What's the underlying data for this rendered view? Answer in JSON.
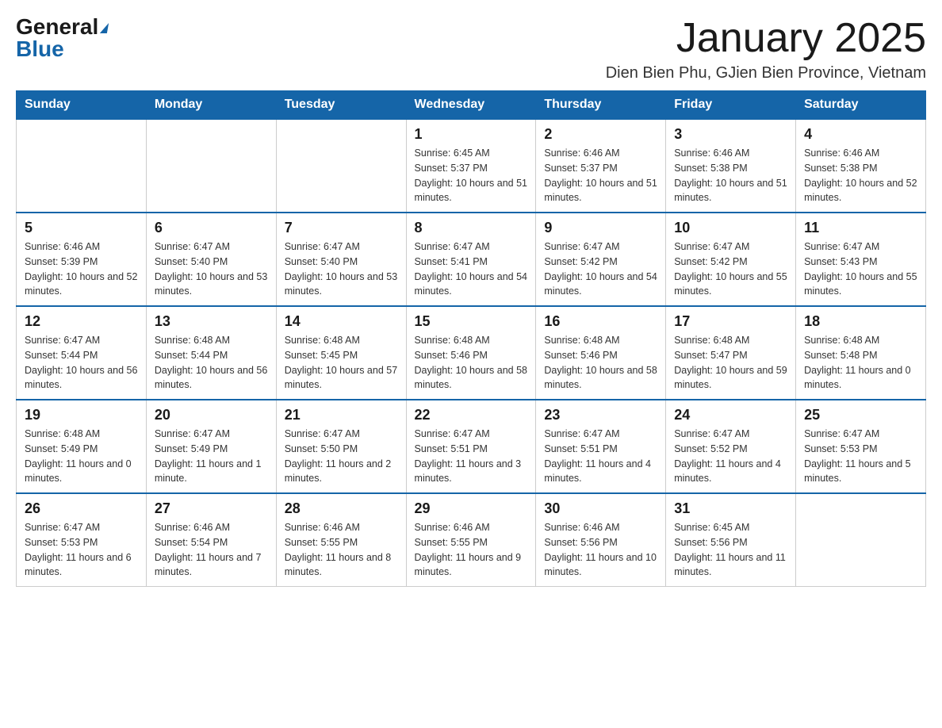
{
  "logo": {
    "general": "General",
    "blue": "Blue"
  },
  "header": {
    "month": "January 2025",
    "location": "Dien Bien Phu, GJien Bien Province, Vietnam"
  },
  "weekdays": [
    "Sunday",
    "Monday",
    "Tuesday",
    "Wednesday",
    "Thursday",
    "Friday",
    "Saturday"
  ],
  "weeks": [
    [
      {
        "day": "",
        "info": ""
      },
      {
        "day": "",
        "info": ""
      },
      {
        "day": "",
        "info": ""
      },
      {
        "day": "1",
        "info": "Sunrise: 6:45 AM\nSunset: 5:37 PM\nDaylight: 10 hours and 51 minutes."
      },
      {
        "day": "2",
        "info": "Sunrise: 6:46 AM\nSunset: 5:37 PM\nDaylight: 10 hours and 51 minutes."
      },
      {
        "day": "3",
        "info": "Sunrise: 6:46 AM\nSunset: 5:38 PM\nDaylight: 10 hours and 51 minutes."
      },
      {
        "day": "4",
        "info": "Sunrise: 6:46 AM\nSunset: 5:38 PM\nDaylight: 10 hours and 52 minutes."
      }
    ],
    [
      {
        "day": "5",
        "info": "Sunrise: 6:46 AM\nSunset: 5:39 PM\nDaylight: 10 hours and 52 minutes."
      },
      {
        "day": "6",
        "info": "Sunrise: 6:47 AM\nSunset: 5:40 PM\nDaylight: 10 hours and 53 minutes."
      },
      {
        "day": "7",
        "info": "Sunrise: 6:47 AM\nSunset: 5:40 PM\nDaylight: 10 hours and 53 minutes."
      },
      {
        "day": "8",
        "info": "Sunrise: 6:47 AM\nSunset: 5:41 PM\nDaylight: 10 hours and 54 minutes."
      },
      {
        "day": "9",
        "info": "Sunrise: 6:47 AM\nSunset: 5:42 PM\nDaylight: 10 hours and 54 minutes."
      },
      {
        "day": "10",
        "info": "Sunrise: 6:47 AM\nSunset: 5:42 PM\nDaylight: 10 hours and 55 minutes."
      },
      {
        "day": "11",
        "info": "Sunrise: 6:47 AM\nSunset: 5:43 PM\nDaylight: 10 hours and 55 minutes."
      }
    ],
    [
      {
        "day": "12",
        "info": "Sunrise: 6:47 AM\nSunset: 5:44 PM\nDaylight: 10 hours and 56 minutes."
      },
      {
        "day": "13",
        "info": "Sunrise: 6:48 AM\nSunset: 5:44 PM\nDaylight: 10 hours and 56 minutes."
      },
      {
        "day": "14",
        "info": "Sunrise: 6:48 AM\nSunset: 5:45 PM\nDaylight: 10 hours and 57 minutes."
      },
      {
        "day": "15",
        "info": "Sunrise: 6:48 AM\nSunset: 5:46 PM\nDaylight: 10 hours and 58 minutes."
      },
      {
        "day": "16",
        "info": "Sunrise: 6:48 AM\nSunset: 5:46 PM\nDaylight: 10 hours and 58 minutes."
      },
      {
        "day": "17",
        "info": "Sunrise: 6:48 AM\nSunset: 5:47 PM\nDaylight: 10 hours and 59 minutes."
      },
      {
        "day": "18",
        "info": "Sunrise: 6:48 AM\nSunset: 5:48 PM\nDaylight: 11 hours and 0 minutes."
      }
    ],
    [
      {
        "day": "19",
        "info": "Sunrise: 6:48 AM\nSunset: 5:49 PM\nDaylight: 11 hours and 0 minutes."
      },
      {
        "day": "20",
        "info": "Sunrise: 6:47 AM\nSunset: 5:49 PM\nDaylight: 11 hours and 1 minute."
      },
      {
        "day": "21",
        "info": "Sunrise: 6:47 AM\nSunset: 5:50 PM\nDaylight: 11 hours and 2 minutes."
      },
      {
        "day": "22",
        "info": "Sunrise: 6:47 AM\nSunset: 5:51 PM\nDaylight: 11 hours and 3 minutes."
      },
      {
        "day": "23",
        "info": "Sunrise: 6:47 AM\nSunset: 5:51 PM\nDaylight: 11 hours and 4 minutes."
      },
      {
        "day": "24",
        "info": "Sunrise: 6:47 AM\nSunset: 5:52 PM\nDaylight: 11 hours and 4 minutes."
      },
      {
        "day": "25",
        "info": "Sunrise: 6:47 AM\nSunset: 5:53 PM\nDaylight: 11 hours and 5 minutes."
      }
    ],
    [
      {
        "day": "26",
        "info": "Sunrise: 6:47 AM\nSunset: 5:53 PM\nDaylight: 11 hours and 6 minutes."
      },
      {
        "day": "27",
        "info": "Sunrise: 6:46 AM\nSunset: 5:54 PM\nDaylight: 11 hours and 7 minutes."
      },
      {
        "day": "28",
        "info": "Sunrise: 6:46 AM\nSunset: 5:55 PM\nDaylight: 11 hours and 8 minutes."
      },
      {
        "day": "29",
        "info": "Sunrise: 6:46 AM\nSunset: 5:55 PM\nDaylight: 11 hours and 9 minutes."
      },
      {
        "day": "30",
        "info": "Sunrise: 6:46 AM\nSunset: 5:56 PM\nDaylight: 11 hours and 10 minutes."
      },
      {
        "day": "31",
        "info": "Sunrise: 6:45 AM\nSunset: 5:56 PM\nDaylight: 11 hours and 11 minutes."
      },
      {
        "day": "",
        "info": ""
      }
    ]
  ]
}
